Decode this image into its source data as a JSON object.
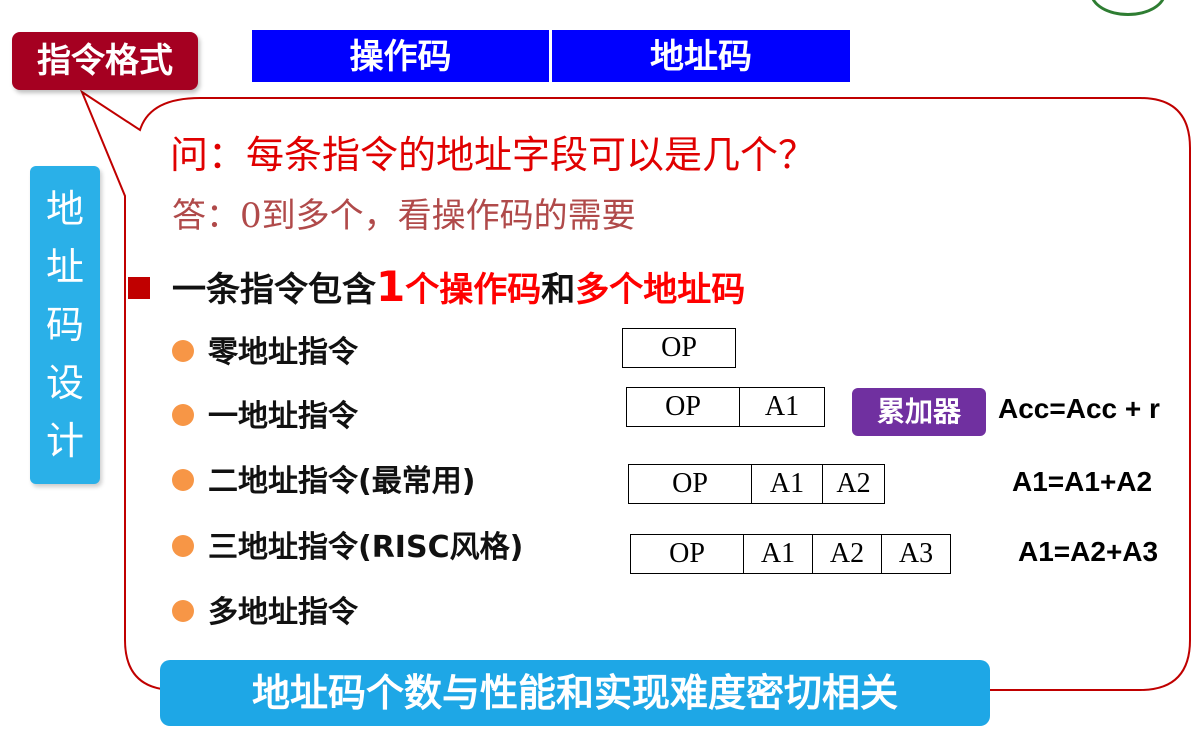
{
  "tag": "指令格式",
  "header": {
    "opcode": "操作码",
    "address": "地址码"
  },
  "side_label": [
    "地",
    "址",
    "码",
    "设",
    "计"
  ],
  "question": "问：每条指令的地址字段可以是几个？",
  "answer": "答：0到多个，看操作码的需要",
  "main_point": {
    "part1": "一条指令包含",
    "one": "1",
    "part2": "个操作码",
    "part3": "和",
    "part4": "多个地址码"
  },
  "items": [
    "零地址指令",
    "一地址指令",
    "二地址指令(最常用)",
    "三地址指令(RISC风格)",
    "多地址指令"
  ],
  "formats": {
    "zero": [
      "OP"
    ],
    "one": [
      "OP",
      "A1"
    ],
    "two": [
      "OP",
      "A1",
      "A2"
    ],
    "three": [
      "OP",
      "A1",
      "A2",
      "A3"
    ]
  },
  "accumulator": "累加器",
  "formulas": {
    "one": "Acc=Acc + r",
    "two": "A1=A1+A2",
    "three": "A1=A2+A3"
  },
  "bottom": "地址码个数与性能和实现难度密切相关",
  "colors": {
    "tag_bg": "#a50021",
    "header_bg": "#0000ff",
    "side_bg": "#2ab0e8",
    "bubble_border": "#c00000",
    "question": "#e00000",
    "bullet_dot": "#f79646",
    "accumulator_bg": "#7030a0",
    "bottom_bg": "#1ea7e6"
  }
}
